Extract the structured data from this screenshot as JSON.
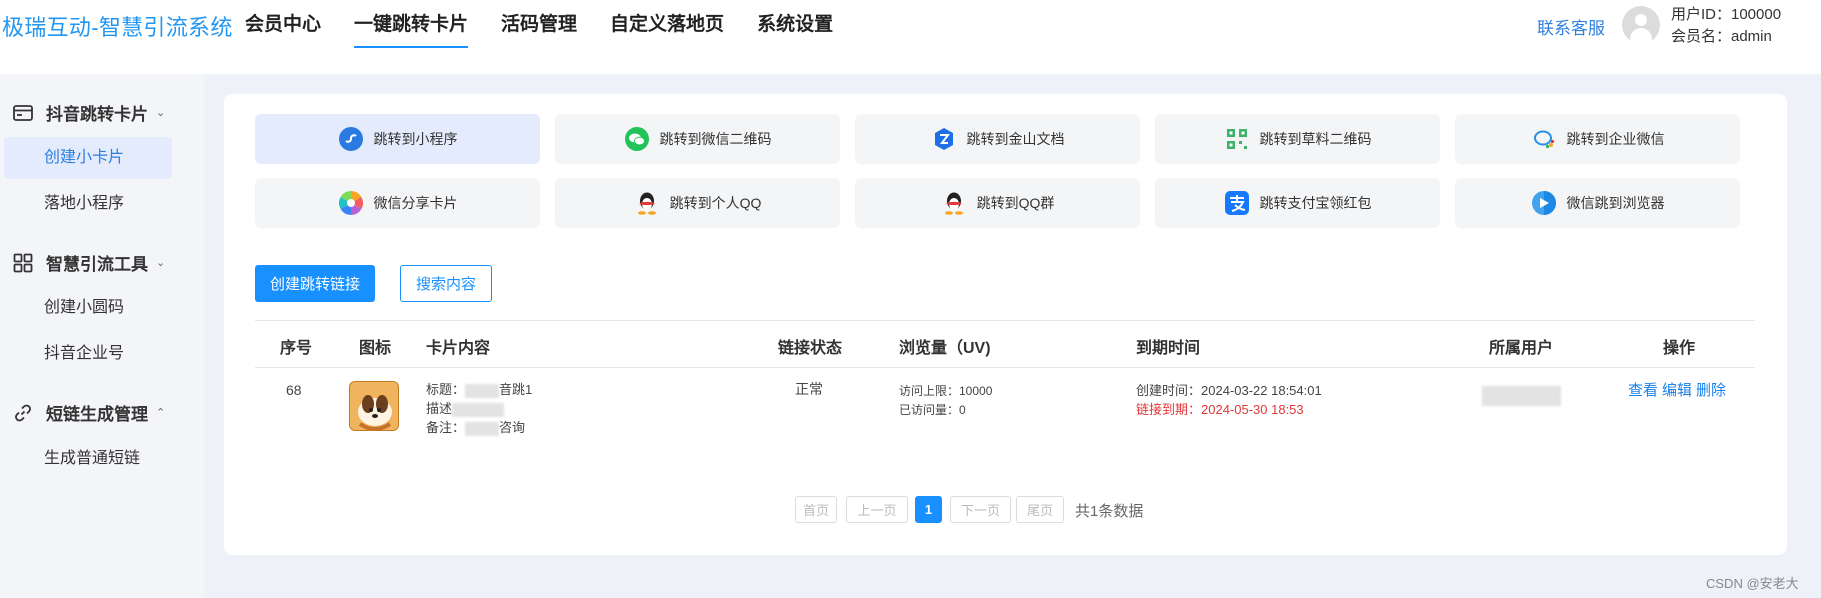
{
  "header": {
    "brand": "极瑞互动-智慧引流系统",
    "nav": [
      {
        "label": "会员中心",
        "active": false
      },
      {
        "label": "一键跳转卡片",
        "active": true
      },
      {
        "label": "活码管理",
        "active": false
      },
      {
        "label": "自定义落地页",
        "active": false
      },
      {
        "label": "系统设置",
        "active": false
      }
    ],
    "contact": "联系客服",
    "user_id": "用户ID：100000",
    "user_name": "会员名：admin"
  },
  "sidebar": {
    "groups": [
      {
        "label": "抖音跳转卡片",
        "icon": "card-icon",
        "chevron": "chevron-down-icon",
        "items": [
          {
            "label": "创建小卡片",
            "active": true
          },
          {
            "label": "落地小程序",
            "active": false
          }
        ]
      },
      {
        "label": "智慧引流工具",
        "icon": "grid-icon",
        "chevron": "chevron-down-icon",
        "items": [
          {
            "label": "创建小圆码",
            "active": false
          },
          {
            "label": "抖音企业号",
            "active": false
          }
        ]
      },
      {
        "label": "短链生成管理",
        "icon": "link-icon",
        "chevron": "chevron-up-icon",
        "items": [
          {
            "label": "生成普通短链",
            "active": false
          }
        ]
      }
    ]
  },
  "cards": [
    {
      "label": "跳转到小程序",
      "icon": "miniprogram-icon",
      "active": true
    },
    {
      "label": "跳转到微信二维码",
      "icon": "wechat-icon",
      "active": false
    },
    {
      "label": "跳转到金山文档",
      "icon": "kdocs-icon",
      "active": false
    },
    {
      "label": "跳转到草料二维码",
      "icon": "qrcode-icon",
      "active": false
    },
    {
      "label": "跳转到企业微信",
      "icon": "wecom-icon",
      "active": false
    },
    {
      "label": "微信分享卡片",
      "icon": "share-icon",
      "active": false
    },
    {
      "label": "跳转到个人QQ",
      "icon": "qq-icon",
      "active": false
    },
    {
      "label": "跳转到QQ群",
      "icon": "qq-group-icon",
      "active": false
    },
    {
      "label": "跳转支付宝领红包",
      "icon": "alipay-icon",
      "active": false
    },
    {
      "label": "微信跳到浏览器",
      "icon": "browser-icon",
      "active": false
    }
  ],
  "actions": {
    "create": "创建跳转链接",
    "search": "搜索内容"
  },
  "table": {
    "headers": [
      "序号",
      "图标",
      "卡片内容",
      "链接状态",
      "浏览量（UV)",
      "到期时间",
      "所属用户",
      "操作"
    ],
    "rows": [
      {
        "index": "68",
        "title_prefix": "标题：",
        "title_tail": "音跳1",
        "desc_prefix": "描述",
        "note_prefix": "备注：",
        "note_tail": "咨询",
        "status": "正常",
        "visit_limit": "访问上限：10000",
        "visited": "已访问量：0",
        "created": "创建时间：2024-03-22 18:54:01",
        "expires": "链接到期：2024-05-30 18:53",
        "ops": [
          "查看",
          "编辑",
          "删除"
        ]
      }
    ]
  },
  "pagination": {
    "first": "首页",
    "prev": "上一页",
    "current": "1",
    "next": "下一页",
    "last": "尾页",
    "total": "共1条数据"
  },
  "watermark": "CSDN @安老大",
  "colors": {
    "accent": "#1990ff",
    "danger": "#e23838",
    "bg": "#eef1f8"
  }
}
